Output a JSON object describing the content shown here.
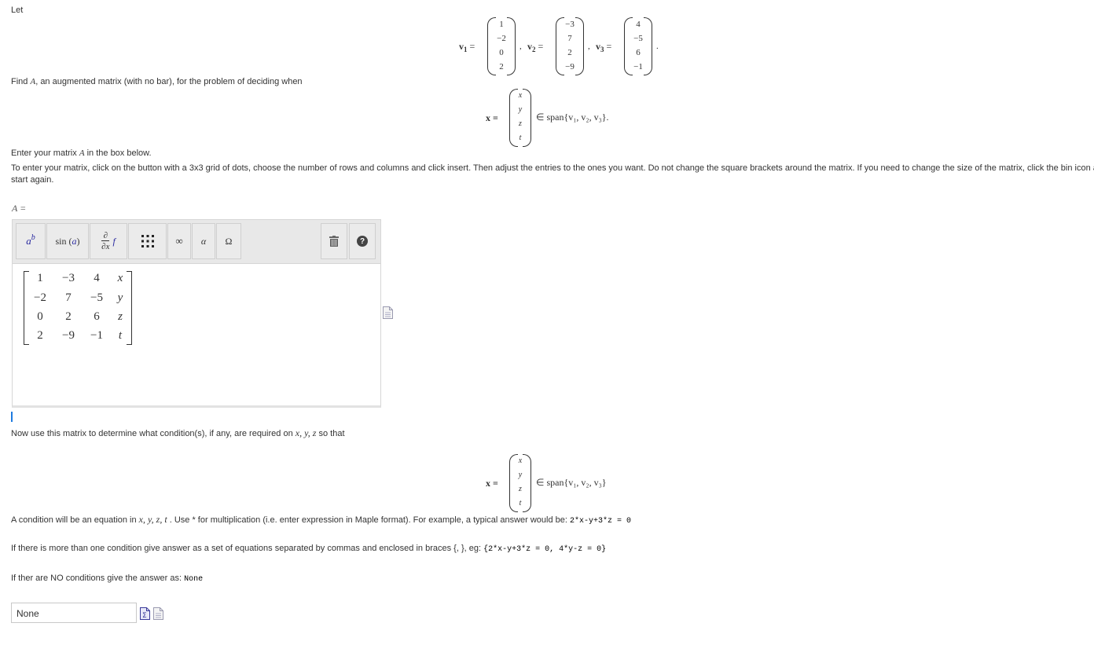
{
  "intro": {
    "let": "Let"
  },
  "vectors": {
    "v1": {
      "name": "v",
      "sub": "1",
      "entries": [
        "1",
        "−2",
        "0",
        "2"
      ]
    },
    "v2": {
      "name": "v",
      "sub": "2",
      "entries": [
        "−3",
        "7",
        "2",
        "−9"
      ]
    },
    "v3": {
      "name": "v",
      "sub": "3",
      "entries": [
        "4",
        "−5",
        "6",
        "−1"
      ]
    },
    "eq": "=",
    "comma": ",",
    "period": "."
  },
  "find": {
    "prefix": "Find ",
    "A": "A",
    "suffix": ", an augmented matrix (with no bar), for the problem of deciding when"
  },
  "xvec": {
    "lhs": "x =",
    "entries": [
      "x",
      "y",
      "z",
      "t"
    ],
    "span1": "∈ span{v₁, v₂, v₃}.",
    "span2": "∈ span{v₁, v₂, v₃}"
  },
  "enter_matrix": {
    "prefix": "Enter your matrix ",
    "A": "A",
    "suffix": " in the box below."
  },
  "instructions": "To enter your matrix, click on the button with a 3x3 grid of dots, choose the number of rows and columns and click insert.  Then adjust the entries to the ones you want.  Do not change the square brackets around the matrix.  If you need to change the size of the matrix, click the bin icon and",
  "instructions2": "start again.",
  "a_label": "A =",
  "toolbar": {
    "superscript": "a",
    "superscript_b": "b",
    "sin_label": "sin",
    "sin_arg": "a",
    "deriv_top": "∂",
    "deriv_bottom": "∂x",
    "deriv_f": "f",
    "infinity": "∞",
    "alpha": "α",
    "omega": "Ω",
    "help": "?"
  },
  "matrix": {
    "rows": [
      [
        "1",
        "−3",
        "4",
        "x"
      ],
      [
        "−2",
        "7",
        "−5",
        "y"
      ],
      [
        "0",
        "2",
        "6",
        "z"
      ],
      [
        "2",
        "−9",
        "−1",
        "t"
      ]
    ]
  },
  "now_use": {
    "prefix": "Now use this matrix to determine what condition(s), if any, are required on ",
    "vars": "x, y, z",
    "suffix": " so that"
  },
  "condition": {
    "prefix": "A condition will be an equation in ",
    "vars": "x, y, z, t",
    "middle": " .  Use * for multiplication (i.e. enter expression in Maple format).  For example, a typical answer would be: ",
    "example": "2*x-y+3*z = 0"
  },
  "multiple": {
    "prefix": "If there is more than one condition give answer as a set of equations separated by commas and enclosed in braces {, }, eg: ",
    "example": "{2*x-y+3*z = 0, 4*y-z = 0}"
  },
  "none": {
    "prefix": "If ther are NO conditions give the answer as: ",
    "example": "None"
  },
  "answer": {
    "value": "None"
  }
}
